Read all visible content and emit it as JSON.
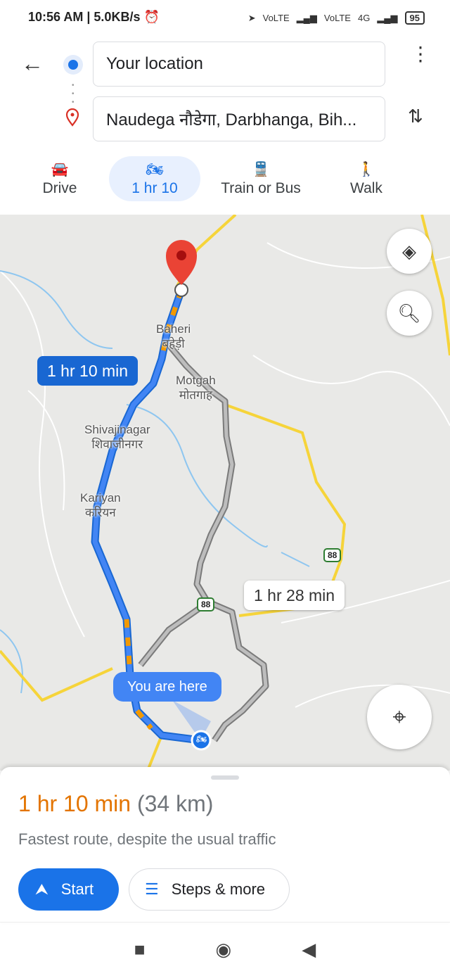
{
  "status_bar": {
    "time": "10:56 AM",
    "speed": "5.0KB/s",
    "signal1": "VoLTE",
    "signal2": "VoLTE",
    "network": "4G",
    "battery": "95"
  },
  "search": {
    "origin": "Your location",
    "destination": "Naudega नौडेगा, Darbhanga, Bih..."
  },
  "modes": [
    {
      "label": "Drive",
      "icon": "car-icon"
    },
    {
      "label": "1 hr 10",
      "icon": "motorcycle-icon",
      "active": true
    },
    {
      "label": "Train or Bus",
      "icon": "train-icon"
    },
    {
      "label": "Walk",
      "icon": "walk-icon"
    }
  ],
  "map": {
    "places": [
      {
        "name": "Baheri",
        "local": "बहेड़ी"
      },
      {
        "name": "Motgah",
        "local": "मोतगाह"
      },
      {
        "name": "Shivajinagar",
        "local": "शिवाजीनगर"
      },
      {
        "name": "Kariyan",
        "local": "करियन"
      }
    ],
    "highway_shields": [
      "88",
      "88"
    ],
    "route_callout": "1 hr 10 min",
    "alt_route_callout": "1 hr 28 min",
    "you_are_here": "You are here",
    "colors": {
      "route": "#4285f4",
      "traffic": "#f29900",
      "alternate": "#9e9e9e",
      "highway": "#f6d43a",
      "water": "#8ec6f0",
      "destination_pin": "#ea4335"
    }
  },
  "summary": {
    "duration": "1 hr 10 min",
    "distance": "(34 km)",
    "description": "Fastest route, despite the usual traffic",
    "start_label": "Start",
    "steps_label": "Steps & more"
  },
  "colors": {
    "accent": "#1a73e8",
    "duration": "#e37400"
  }
}
